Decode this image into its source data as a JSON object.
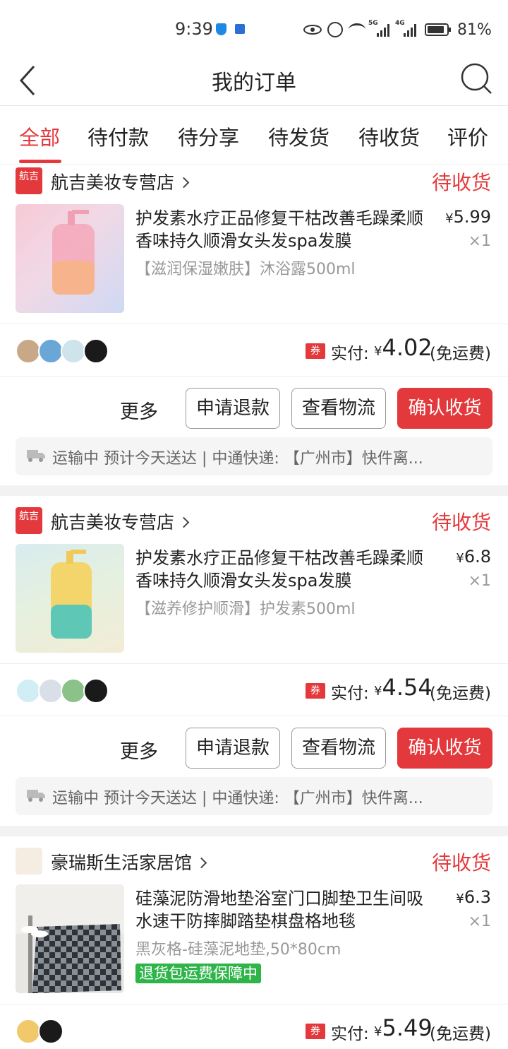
{
  "status_bar": {
    "time": "9:39",
    "battery": "81%",
    "net1": "5G",
    "net2": "4G"
  },
  "header": {
    "title": "我的订单"
  },
  "tabs": [
    {
      "label": "全部",
      "active": true
    },
    {
      "label": "待付款"
    },
    {
      "label": "待分享"
    },
    {
      "label": "待发货"
    },
    {
      "label": "待收货"
    },
    {
      "label": "评价"
    }
  ],
  "orders": [
    {
      "shop": "航吉美妆专营店",
      "shop_logo": "航吉",
      "status": "待收货",
      "product_title": "护发素水疗正品修复干枯改善毛躁柔顺香味持久顺滑女头发spa发膜",
      "spec": "【滋润保湿嫩肤】沐浴露500ml",
      "price": "5.99",
      "qty": "×1",
      "coupon": "券",
      "paid_label": "实付:",
      "paid_amount": "4.02",
      "freight": "(免运费)",
      "more": "更多",
      "btn_refund": "申请退款",
      "btn_logistics": "查看物流",
      "btn_confirm": "确认收货",
      "logistics": "运输中 预计今天送达 | 中通快递: 【广州市】快件离..."
    },
    {
      "shop": "航吉美妆专营店",
      "shop_logo": "航吉",
      "status": "待收货",
      "product_title": "护发素水疗正品修复干枯改善毛躁柔顺香味持久顺滑女头发spa发膜",
      "spec": "【滋养修护顺滑】护发素500ml",
      "price": "6.8",
      "qty": "×1",
      "coupon": "券",
      "paid_label": "实付:",
      "paid_amount": "4.54",
      "freight": "(免运费)",
      "more": "更多",
      "btn_refund": "申请退款",
      "btn_logistics": "查看物流",
      "btn_confirm": "确认收货",
      "logistics": "运输中 预计今天送达 | 中通快递: 【广州市】快件离..."
    },
    {
      "shop": "豪瑞斯生活家居馆",
      "status": "待收货",
      "product_title": "硅藻泥防滑地垫浴室门口脚垫卫生间吸水速干防摔脚踏垫棋盘格地毯",
      "spec": "黑灰格-硅藻泥地垫,50*80cm",
      "badge": "退货包运费保障中",
      "price": "6.3",
      "qty": "×1",
      "coupon": "券",
      "paid_label": "实付:",
      "paid_amount": "5.49",
      "freight": "(免运费)"
    }
  ],
  "currency": "¥",
  "colors": {
    "accent": "#e4393c",
    "badge_green": "#2fb44a"
  }
}
